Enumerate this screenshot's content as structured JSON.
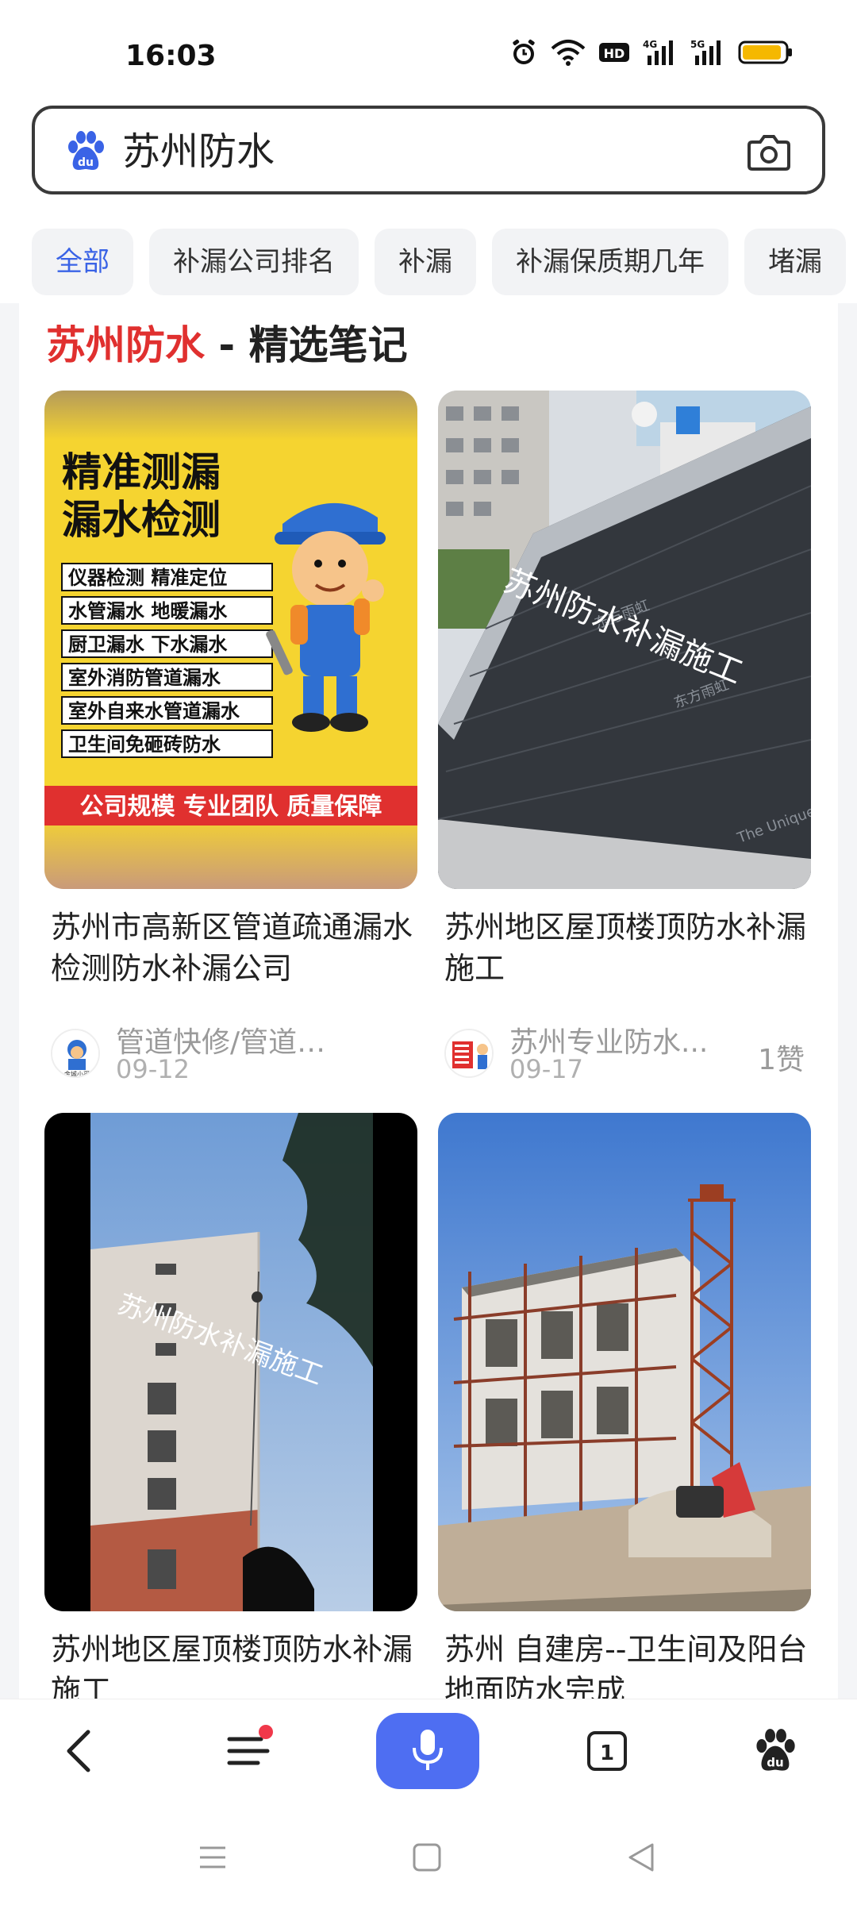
{
  "status_bar": {
    "time": "16:03",
    "icons": [
      "alarm-icon",
      "wifi-icon",
      "hd-icon",
      "signal-4g-icon",
      "signal-5g-icon",
      "battery-icon"
    ],
    "hd_label": "HD",
    "net1": "4G",
    "net2": "5G",
    "battery_color": "#f5b800"
  },
  "search": {
    "query": "苏州防水",
    "logo": "baidu-paw-icon",
    "camera": "camera-icon",
    "accent": "#3a63e6"
  },
  "tabs": [
    {
      "label": "全部",
      "active": true
    },
    {
      "label": "补漏公司排名",
      "active": false
    },
    {
      "label": "补漏",
      "active": false
    },
    {
      "label": "补漏保质期几年",
      "active": false
    },
    {
      "label": "堵漏",
      "active": false
    }
  ],
  "section": {
    "highlight": "苏州防水",
    "rest": " - 精选笔记",
    "highlight_color": "#e0302f"
  },
  "notes": [
    {
      "title": "苏州市高新区管道疏通漏水检测防水补漏公司",
      "author": "管道快修/管道测漏...",
      "date": "09-12",
      "likes": "",
      "poster": {
        "headline1": "精准测漏",
        "headline2": "漏水检测",
        "rows": [
          "仪器检测 精准定位",
          "水管漏水 地暖漏水",
          "厨卫漏水 下水漏水",
          "室外消防管道漏水",
          "室外自来水管道漏水",
          "卫生间免砸砖防水"
        ],
        "footer": "公司规模 专业团队 质量保障",
        "avatar_text": "金城小哥"
      }
    },
    {
      "title": "苏州地区屋顶楼顶防水补漏施工",
      "author": "苏州专业防水...",
      "date": "09-17",
      "likes": "1赞",
      "poster": {
        "watermark": "苏州防水补漏施工",
        "brand1": "东方雨虹",
        "brand2": "The Unique"
      }
    },
    {
      "title": "苏州地区屋顶楼顶防水补漏施工",
      "author": "",
      "date": "",
      "likes": "",
      "poster": {
        "watermark": "苏州防水补漏施工"
      }
    },
    {
      "title": "苏州 自建房--卫生间及阳台地面防水完成",
      "author": "",
      "date": "",
      "likes": "",
      "poster": {}
    }
  ],
  "bottom_nav": {
    "items": [
      "back-icon",
      "menu-icon",
      "microphone-icon",
      "tabs-icon",
      "baidu-home-icon"
    ],
    "tab_count": "1",
    "voice_color": "#4e6ef2",
    "badge_color": "#f0384a"
  },
  "system_nav": [
    "recents-icon",
    "home-icon",
    "back-triangle-icon"
  ]
}
